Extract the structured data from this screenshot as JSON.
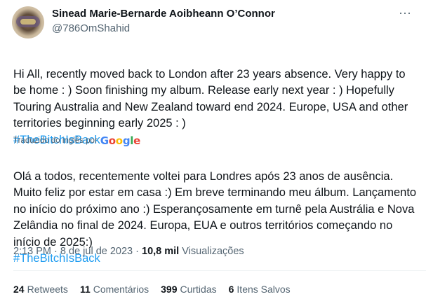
{
  "user": {
    "name": "Sinead Marie-Bernarde Aoibheann O’Connor",
    "handle": "@786OmShahid"
  },
  "more_icon": "more-horizontal-icon",
  "tweet": {
    "text": "Hi All, recently moved back to London after 23 years absence. Very happy to be home : )  Soon finishing my album. Release early next year : ) Hopefully Touring Australia and New Zealand toward end 2024. Europe, USA and other territories beginning early 2025 : )",
    "hashtag": "#TheBitchIsBack"
  },
  "translation": {
    "label": "Traduzido do inglês por",
    "provider": "Google",
    "text": "Olá a todos, recentemente voltei para Londres após 23 anos de ausência. Muito feliz por estar em casa :) Em breve terminando meu álbum. Lançamento no início do próximo ano :) Esperançosamente em turnê pela Austrália e Nova Zelândia no final de 2024. Europa, EUA e outros territórios começando no início de 2025:)",
    "hashtag": "#TheBitchIsBack"
  },
  "meta": {
    "time": "2:13 PM",
    "separator": "·",
    "date": "8 de jul de 2023",
    "views_count": "10,8 mil",
    "views_label": "Visualizações"
  },
  "stats": [
    {
      "count": "24",
      "label": "Retweets"
    },
    {
      "count": "11",
      "label": "Comentários"
    },
    {
      "count": "399",
      "label": "Curtidas"
    },
    {
      "count": "6",
      "label": "Itens Salvos"
    }
  ],
  "colors": {
    "link": "#1d9bf0",
    "secondary_text": "#536471",
    "primary_text": "#0f1419"
  }
}
